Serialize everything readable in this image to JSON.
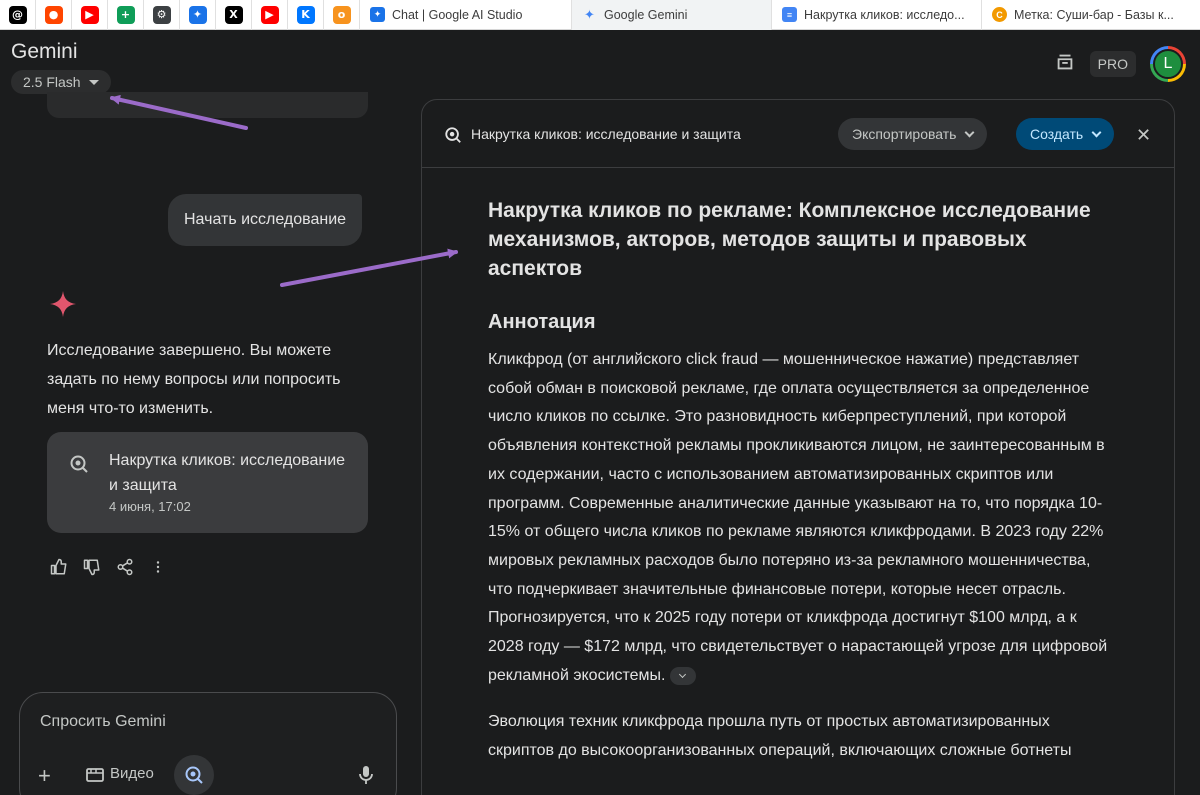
{
  "browser": {
    "pinned_tabs": [
      {
        "icon": "threads-icon",
        "color": "#000000",
        "glyph": "@"
      },
      {
        "icon": "reddit-icon",
        "color": "#ff4500",
        "glyph": "●"
      },
      {
        "icon": "youtube-icon",
        "color": "#ff0000",
        "glyph": "▶"
      },
      {
        "icon": "sheets-icon",
        "color": "#0f9d58",
        "glyph": "+"
      },
      {
        "icon": "settings-icon",
        "color": "#3c4043",
        "glyph": "⚙"
      },
      {
        "icon": "bluesky-icon",
        "color": "#1a73e8",
        "glyph": "✦"
      },
      {
        "icon": "x-icon",
        "color": "#000000",
        "glyph": "X"
      },
      {
        "icon": "youtube-icon",
        "color": "#ff0000",
        "glyph": "▶"
      },
      {
        "icon": "vk-icon",
        "color": "#0077ff",
        "glyph": "K"
      },
      {
        "icon": "ok-icon",
        "color": "#f7931e",
        "glyph": "o"
      }
    ],
    "tabs": [
      {
        "label": "Chat | Google AI Studio",
        "icon": "ai-studio-icon",
        "color": "#1a73e8"
      },
      {
        "label": "Google Gemini",
        "icon": "gemini-icon",
        "color": "#4285f4"
      },
      {
        "label": "Накрутка кликов: исследо...",
        "icon": "docs-icon",
        "color": "#4285f4"
      },
      {
        "label": "Метка: Суши-бар - Базы к...",
        "icon": "site-icon",
        "color": "#f29900"
      }
    ]
  },
  "header": {
    "title": "Gemini",
    "model": "2.5 Flash",
    "pro_badge": "PRO",
    "avatar_letter": "L"
  },
  "chat": {
    "user_message": "Начать исследование",
    "response": "Исследование завершено. Вы можете задать по нему вопросы или попросить меня что-то изменить.",
    "doc_card": {
      "title": "Накрутка кликов: исследование и защита",
      "date": "4 июня, 17:02"
    }
  },
  "input": {
    "placeholder": "Спросить Gemini",
    "video_label": "Видео"
  },
  "panel": {
    "title": "Накрутка кликов: исследование и защита",
    "export_label": "Экспортировать",
    "create_label": "Создать",
    "doc_title": "Накрутка кликов по рекламе: Комплексное исследование механизмов, акторов, методов защиты и правовых аспектов",
    "section_heading": "Аннотация",
    "paragraph_1": "Кликфрод (от английского click fraud — мошенническое нажатие) представляет собой обман в поисковой рекламе, где оплата осуществляется за определенное число кликов по ссылке. Это разновидность киберпреступлений, при которой объявления контекстной рекламы прокликиваются лицом, не заинтересованным в их содержании, часто с использованием автоматизированных скриптов или программ. Современные аналитические данные указывают на то, что порядка 10-15% от общего числа кликов по рекламе являются кликфродами. В 2023 году 22% мировых рекламных расходов было потеряно из-за рекламного мошенничества, что подчеркивает значительные финансовые потери, которые несет отрасль. Прогнозируется, что к 2025 году потери от кликфрода достигнут $100 млрд, а к 2028 году — $172 млрд, что свидетельствует о нарастающей угрозе для цифровой рекламной экосистемы.",
    "paragraph_2": "Эволюция техник кликфрода прошла путь от простых автоматизированных скриптов до высокоорганизованных операций, включающих сложные ботнеты"
  },
  "colors": {
    "background": "#1b1c1d",
    "annotation_arrow": "#9b6bc9",
    "create_button": "#004a77",
    "gemini_spark": "#e0566d"
  }
}
